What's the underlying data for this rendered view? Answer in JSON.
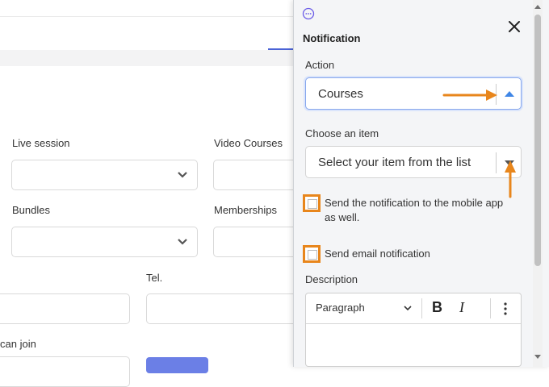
{
  "background_form": {
    "fields": [
      {
        "label": "Live session"
      },
      {
        "label": "Video Courses"
      },
      {
        "label": "Bundles"
      },
      {
        "label": "Memberships"
      },
      {
        "label": "Tel."
      },
      {
        "label": "can join"
      }
    ]
  },
  "panel": {
    "title": "Notification",
    "action": {
      "label": "Action",
      "value": "Courses"
    },
    "item": {
      "label": "Choose an item",
      "placeholder": "Select your item from the list"
    },
    "mobile_checkbox": {
      "label": "Send the notification to the mobile app as well."
    },
    "email_checkbox": {
      "label": "Send email notification"
    },
    "description": {
      "label": "Description",
      "toolbar": {
        "heading_select": "Paragraph",
        "bold": "B",
        "italic": "I"
      }
    }
  },
  "colors": {
    "highlight": "#e8861c",
    "accent": "#3f86e6",
    "brand_button": "#6b7fe6"
  },
  "icons": [
    "chat-icon",
    "close-icon",
    "chevron-down-icon",
    "caret-up-icon",
    "caret-down-icon",
    "more-vertical-icon",
    "arrow-annotation"
  ]
}
